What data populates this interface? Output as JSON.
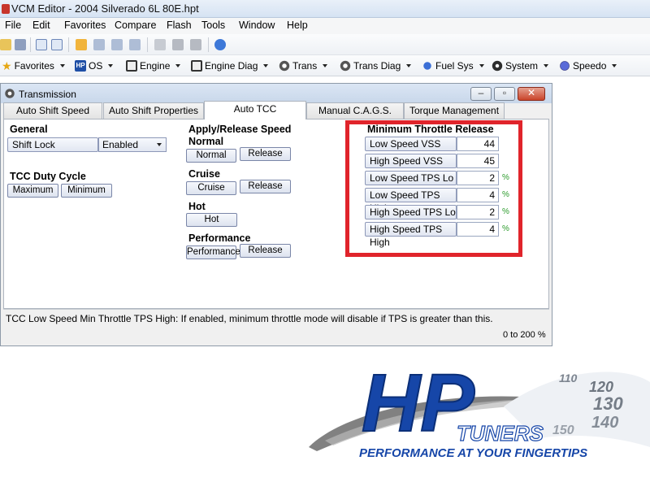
{
  "app": {
    "title": "VCM Editor - 2004 Silverado 6L 80E.hpt"
  },
  "menu": [
    "File",
    "Edit",
    "Favorites",
    "Compare",
    "Flash",
    "Tools",
    "Window",
    "Help"
  ],
  "toolbar2": {
    "favorites": "Favorites",
    "os": "OS",
    "engine": "Engine",
    "engine_diag": "Engine Diag",
    "trans": "Trans",
    "trans_diag": "Trans Diag",
    "fuel_sys": "Fuel Sys",
    "system": "System",
    "speedo": "Speedo"
  },
  "window": {
    "title": "Transmission",
    "tabs": [
      "Auto Shift Speed",
      "Auto Shift Properties",
      "Auto TCC",
      "Manual C.A.G.S.",
      "Torque Management"
    ],
    "active_tab": "Auto TCC",
    "general": {
      "title": "General",
      "shift_lock_label": "Shift Lock",
      "shift_lock_value": "Enabled"
    },
    "duty": {
      "title": "TCC Duty Cycle",
      "maximum": "Maximum",
      "minimum": "Minimum"
    },
    "apply": {
      "title": "Apply/Release Speed",
      "normal_title": "Normal",
      "normal_btn": "Normal",
      "normal_release": "Release",
      "cruise_title": "Cruise",
      "cruise_btn": "Cruise",
      "cruise_release": "Release",
      "hot_title": "Hot",
      "hot_btn": "Hot",
      "perf_title": "Performance",
      "perf_btn": "Performance",
      "perf_release": "Release"
    },
    "min_throttle": {
      "title": "Minimum Throttle Release",
      "rows": [
        {
          "label": "Low Speed VSS",
          "value": "44",
          "unit": ""
        },
        {
          "label": "High Speed VSS",
          "value": "45",
          "unit": ""
        },
        {
          "label": "Low Speed TPS Lo",
          "value": "2",
          "unit": "%"
        },
        {
          "label": "Low Speed TPS High",
          "value": "4",
          "unit": "%"
        },
        {
          "label": "High Speed TPS Lo",
          "value": "2",
          "unit": "%"
        },
        {
          "label": "High Speed TPS High",
          "value": "4",
          "unit": "%"
        }
      ]
    },
    "status": "TCC Low Speed Min Throttle TPS High: If enabled, minimum throttle mode will disable if TPS is greater than this.",
    "range": "0 to 200 %"
  },
  "logo": {
    "brand": "HP",
    "sub": "TUNERS",
    "tagline": "PERFORMANCE AT YOUR FINGERTIPS",
    "gauge_numbers": [
      "110",
      "120",
      "130",
      "140",
      "150"
    ]
  },
  "colors": {
    "highlight": "#e0242b",
    "unit": "#2a9a2a",
    "logo_blue": "#1646a8"
  }
}
